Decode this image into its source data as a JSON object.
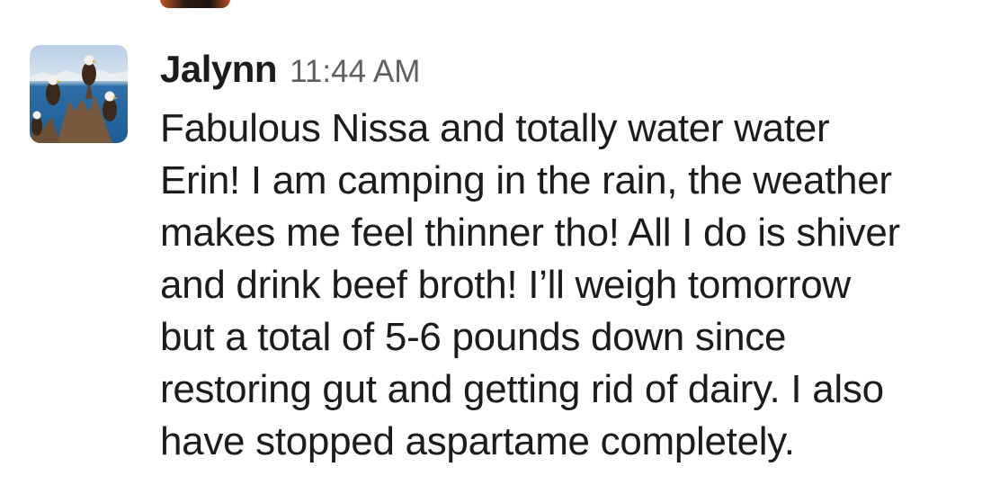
{
  "previous_message": {
    "avatar_icon": "avatar-thumbnail"
  },
  "message": {
    "sender": "Jalynn",
    "timestamp": "11:44 AM",
    "avatar_icon": "eagles-photo-avatar",
    "lines": [
      "Fabulous Nissa and totally water water",
      "Erin! I am camping in the rain, the weather",
      "makes me feel thinner tho! All I do is shiver",
      "and drink beef broth! I’ll weigh tomorrow",
      "but a total of 5-6 pounds down since",
      "restoring gut and getting rid of dairy. I also",
      "have stopped aspartame completely."
    ]
  }
}
